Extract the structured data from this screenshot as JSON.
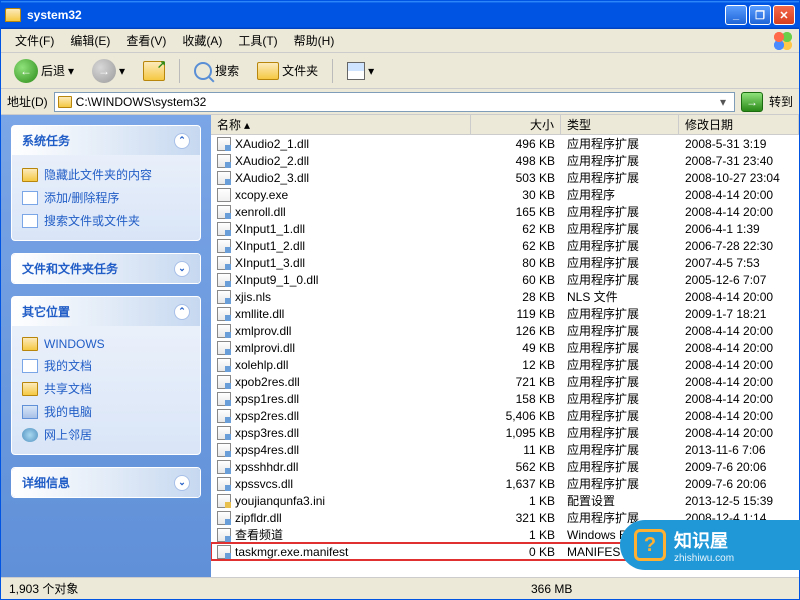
{
  "title": "system32",
  "menu": {
    "file": "文件(F)",
    "edit": "编辑(E)",
    "view": "查看(V)",
    "fav": "收藏(A)",
    "tools": "工具(T)",
    "help": "帮助(H)"
  },
  "toolbar": {
    "back": "后退",
    "search": "搜索",
    "folders": "文件夹"
  },
  "address": {
    "label": "地址(D)",
    "path": "C:\\WINDOWS\\system32",
    "go": "转到"
  },
  "sidebar": {
    "sysTasks": {
      "title": "系统任务",
      "items": [
        "隐藏此文件夹的内容",
        "添加/删除程序",
        "搜索文件或文件夹"
      ]
    },
    "folderTasks": {
      "title": "文件和文件夹任务"
    },
    "otherPlaces": {
      "title": "其它位置",
      "items": [
        "WINDOWS",
        "我的文档",
        "共享文档",
        "我的电脑",
        "网上邻居"
      ]
    },
    "details": {
      "title": "详细信息"
    }
  },
  "columns": {
    "name": "名称",
    "size": "大小",
    "type": "类型",
    "date": "修改日期"
  },
  "files": [
    {
      "n": "XAudio2_1.dll",
      "s": "496 KB",
      "t": "应用程序扩展",
      "d": "2008-5-31 3:19",
      "i": "dll"
    },
    {
      "n": "XAudio2_2.dll",
      "s": "498 KB",
      "t": "应用程序扩展",
      "d": "2008-7-31 23:40",
      "i": "dll"
    },
    {
      "n": "XAudio2_3.dll",
      "s": "503 KB",
      "t": "应用程序扩展",
      "d": "2008-10-27 23:04",
      "i": "dll"
    },
    {
      "n": "xcopy.exe",
      "s": "30 KB",
      "t": "应用程序",
      "d": "2008-4-14 20:00",
      "i": "exe"
    },
    {
      "n": "xenroll.dll",
      "s": "165 KB",
      "t": "应用程序扩展",
      "d": "2008-4-14 20:00",
      "i": "dll"
    },
    {
      "n": "XInput1_1.dll",
      "s": "62 KB",
      "t": "应用程序扩展",
      "d": "2006-4-1 1:39",
      "i": "dll"
    },
    {
      "n": "XInput1_2.dll",
      "s": "62 KB",
      "t": "应用程序扩展",
      "d": "2006-7-28 22:30",
      "i": "dll"
    },
    {
      "n": "XInput1_3.dll",
      "s": "80 KB",
      "t": "应用程序扩展",
      "d": "2007-4-5 7:53",
      "i": "dll"
    },
    {
      "n": "XInput9_1_0.dll",
      "s": "60 KB",
      "t": "应用程序扩展",
      "d": "2005-12-6 7:07",
      "i": "dll"
    },
    {
      "n": "xjis.nls",
      "s": "28 KB",
      "t": "NLS 文件",
      "d": "2008-4-14 20:00",
      "i": "dll"
    },
    {
      "n": "xmllite.dll",
      "s": "119 KB",
      "t": "应用程序扩展",
      "d": "2009-1-7 18:21",
      "i": "dll"
    },
    {
      "n": "xmlprov.dll",
      "s": "126 KB",
      "t": "应用程序扩展",
      "d": "2008-4-14 20:00",
      "i": "dll"
    },
    {
      "n": "xmlprovi.dll",
      "s": "49 KB",
      "t": "应用程序扩展",
      "d": "2008-4-14 20:00",
      "i": "dll"
    },
    {
      "n": "xolehlp.dll",
      "s": "12 KB",
      "t": "应用程序扩展",
      "d": "2008-4-14 20:00",
      "i": "dll"
    },
    {
      "n": "xpob2res.dll",
      "s": "721 KB",
      "t": "应用程序扩展",
      "d": "2008-4-14 20:00",
      "i": "dll"
    },
    {
      "n": "xpsp1res.dll",
      "s": "158 KB",
      "t": "应用程序扩展",
      "d": "2008-4-14 20:00",
      "i": "dll"
    },
    {
      "n": "xpsp2res.dll",
      "s": "5,406 KB",
      "t": "应用程序扩展",
      "d": "2008-4-14 20:00",
      "i": "dll"
    },
    {
      "n": "xpsp3res.dll",
      "s": "1,095 KB",
      "t": "应用程序扩展",
      "d": "2008-4-14 20:00",
      "i": "dll"
    },
    {
      "n": "xpsp4res.dll",
      "s": "11 KB",
      "t": "应用程序扩展",
      "d": "2013-11-6 7:06",
      "i": "dll"
    },
    {
      "n": "xpsshhdr.dll",
      "s": "562 KB",
      "t": "应用程序扩展",
      "d": "2009-7-6 20:06",
      "i": "dll"
    },
    {
      "n": "xpssvcs.dll",
      "s": "1,637 KB",
      "t": "应用程序扩展",
      "d": "2009-7-6 20:06",
      "i": "dll"
    },
    {
      "n": "youjianqunfa3.ini",
      "s": "1 KB",
      "t": "配置设置",
      "d": "2013-12-5 15:39",
      "i": "ini"
    },
    {
      "n": "zipfldr.dll",
      "s": "321 KB",
      "t": "应用程序扩展",
      "d": "2008-12-4 1:14",
      "i": "dll"
    },
    {
      "n": "查看频道",
      "s": "1 KB",
      "t": "Windows Expl",
      "d": "",
      "i": "dll"
    },
    {
      "n": "taskmgr.exe.manifest",
      "s": "0 KB",
      "t": "MANIFEST 文件",
      "d": "",
      "i": "dll",
      "hl": true
    }
  ],
  "status": {
    "objects": "1,903 个对象",
    "size": "366 MB"
  },
  "watermark": {
    "title": "知识屋",
    "url": "zhishiwu.com"
  }
}
